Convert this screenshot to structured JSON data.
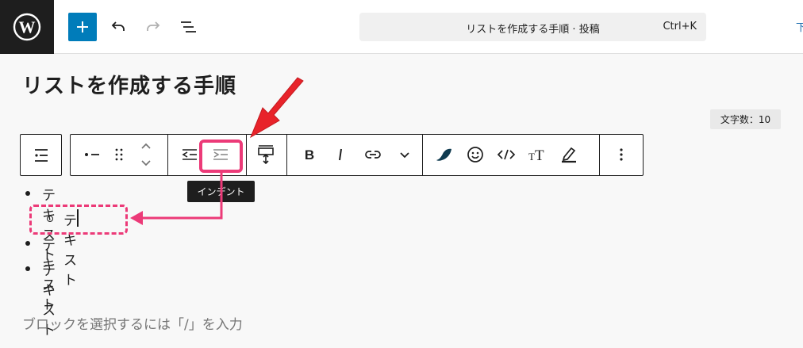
{
  "header": {
    "logo": "wordpress-icon",
    "add_icon": "plus-icon",
    "undo_icon": "undo-icon",
    "redo_icon": "redo-icon",
    "list_view_icon": "list-view-icon",
    "command_title": "リストを作成する手順 · 投稿",
    "command_shortcut": "Ctrl+K",
    "right_cut_text": "下"
  },
  "editor": {
    "post_title": "リストを作成する手順",
    "word_count": "文字数：10",
    "placeholder": "ブロックを選択するには「/」を入力"
  },
  "toolbar": {
    "icons": [
      "parent-list-icon",
      "list-item-icon",
      "drag-handle-icon",
      "move-up-icon",
      "move-down-icon",
      "outdent-icon",
      "indent-icon",
      "split-block-icon",
      "bold-icon",
      "italic-icon",
      "link-icon",
      "more-chevron-icon",
      "highlighter-brand-icon",
      "emoji-icon",
      "code-icon",
      "text-size-icon",
      "highlight-pen-icon",
      "options-icon"
    ],
    "tooltip": "インデント"
  },
  "list": {
    "items": [
      {
        "text": "テキスト",
        "level": 1
      },
      {
        "text": "テキスト",
        "level": 2
      },
      {
        "text": "テキスト",
        "level": 1
      },
      {
        "text": "テキスト",
        "level": 1
      }
    ]
  },
  "annotations": {
    "color": "#ec3a78",
    "arrow_color": "#e8232a"
  },
  "colors": {
    "accent": "#007cba",
    "dark": "#1e1e1e"
  }
}
